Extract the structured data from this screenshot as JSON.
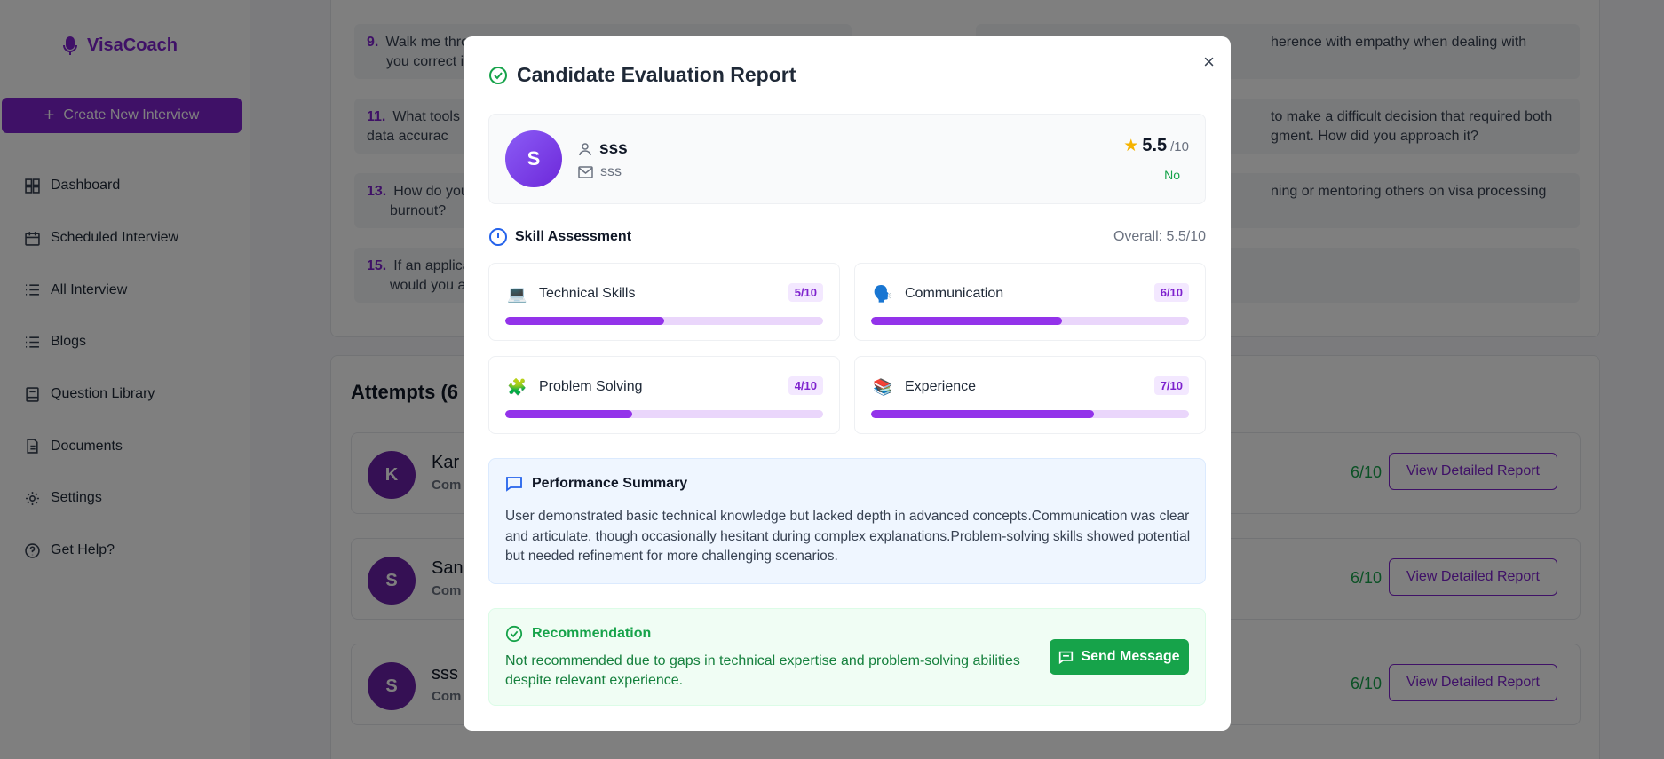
{
  "app": {
    "name": "VisaCoach",
    "create_label": "Create New Interview"
  },
  "sidebar": {
    "items": [
      {
        "label": "Dashboard",
        "icon": "dashboard-icon"
      },
      {
        "label": "Scheduled Interview",
        "icon": "calendar-icon"
      },
      {
        "label": "All Interview",
        "icon": "list-icon"
      },
      {
        "label": "Blogs",
        "icon": "list-icon"
      },
      {
        "label": "Question Library",
        "icon": "book-icon"
      },
      {
        "label": "Documents",
        "icon": "document-icon"
      },
      {
        "label": "Settings",
        "icon": "gear-icon"
      },
      {
        "label": "Get Help?",
        "icon": "help-icon"
      }
    ]
  },
  "questions": [
    {
      "num": "9.",
      "text": "Walk me thro"
    },
    {
      "num": "11.",
      "text": "What tools c"
    },
    {
      "num": "13.",
      "text": "How do you"
    },
    {
      "num": "15.",
      "text": "If an applica"
    },
    {
      "text_l1": "you correct i"
    },
    {
      "text_l1": "data accurac"
    },
    {
      "text_l1": "burnout?"
    },
    {
      "text_l1": "would you a"
    },
    {
      "text": "herence with empathy when dealing with applicants"
    },
    {
      "text": "to make a difficult decision that required both"
    },
    {
      "text": "gment. How did you approach it?"
    },
    {
      "text": "ning or mentoring others on visa processing"
    }
  ],
  "attempts": {
    "title": "Attempts (6",
    "rows": [
      {
        "initial": "K",
        "name": "Kar",
        "status": "Com",
        "score": "6/10",
        "button": "View Detailed Report"
      },
      {
        "initial": "S",
        "name": "San",
        "status": "Com",
        "score": "6/10",
        "button": "View Detailed Report"
      },
      {
        "initial": "S",
        "name": "sss",
        "status": "Com",
        "score": "6/10",
        "button": "View Detailed Report"
      }
    ]
  },
  "modal": {
    "title": "Candidate Evaluation Report",
    "close": "×",
    "candidate": {
      "initial": "S",
      "name": "sss",
      "email": "sss",
      "score": "5.5",
      "score_max": "/10",
      "recommended": "No"
    },
    "skills": {
      "heading": "Skill Assessment",
      "overall": "Overall: 5.5/10",
      "items": [
        {
          "label": "Technical Skills",
          "score": "5/10",
          "value": 5,
          "icon": "💻"
        },
        {
          "label": "Communication",
          "score": "6/10",
          "value": 6,
          "icon": "🗣️"
        },
        {
          "label": "Problem Solving",
          "score": "4/10",
          "value": 4,
          "icon": "🧩"
        },
        {
          "label": "Experience",
          "score": "7/10",
          "value": 7,
          "icon": "📚"
        }
      ]
    },
    "performance": {
      "heading": "Performance Summary",
      "text": "User demonstrated basic technical knowledge but lacked depth in advanced concepts.Communication was clear and articulate, though occasionally hesitant during complex explanations.Problem-solving skills showed potential but needed refinement for more challenging scenarios."
    },
    "recommendation": {
      "heading": "Recommendation",
      "text": "Not recommended due to gaps in technical expertise and problem-solving abilities despite relevant experience.",
      "button": "Send Message"
    }
  },
  "colors": {
    "accent": "#7e22ce",
    "success": "#16a34a",
    "overlay": "rgba(0,0,0,0.5)"
  }
}
